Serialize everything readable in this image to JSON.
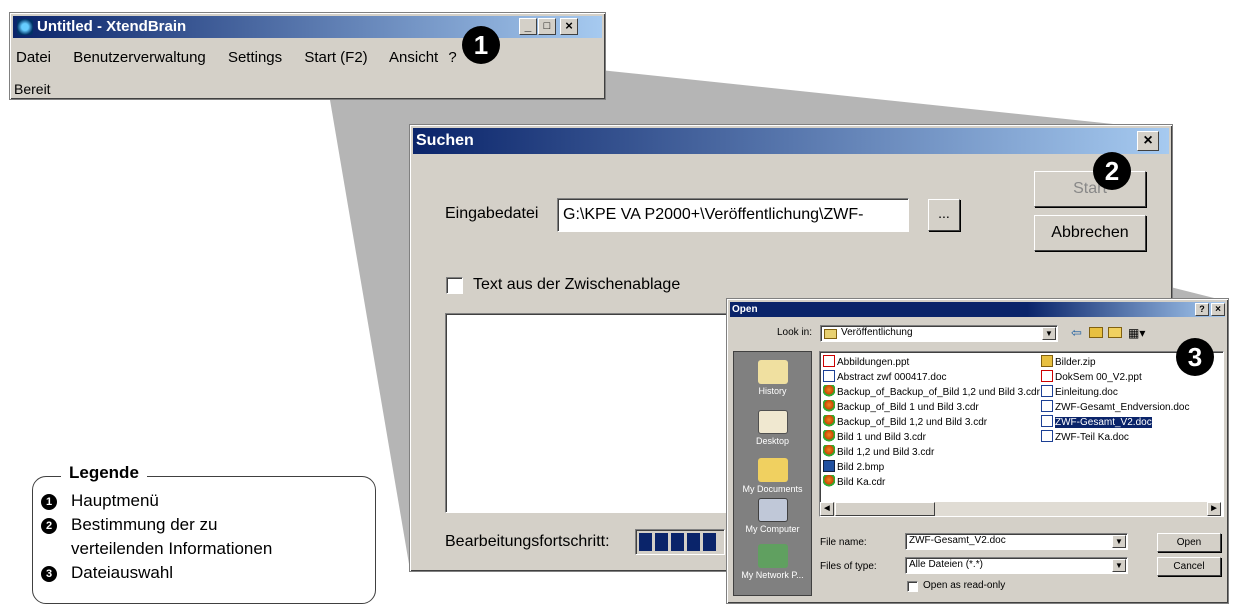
{
  "main_window": {
    "title": "Untitled - XtendBrain",
    "menu": [
      "Datei",
      "Benutzerverwaltung",
      "Settings",
      "Start (F2)",
      "Ansicht",
      "?"
    ],
    "status": "Bereit"
  },
  "search_dialog": {
    "title": "Suchen",
    "input_label": "Eingabedatei",
    "input_value": "G:\\KPE VA P2000+\\Veröffentlichung\\ZWF-",
    "browse_label": "...",
    "start_label": "Start",
    "cancel_label": "Abbrechen",
    "clipboard_label": "Text aus der Zwischenablage",
    "progress_label": "Bearbeitungsfortschritt:",
    "progress_blocks": 5
  },
  "open_dialog": {
    "title": "Open",
    "look_in_label": "Look in:",
    "look_in_value": "Veröffentlichung",
    "places": [
      "History",
      "Desktop",
      "My Documents",
      "My Computer",
      "My Network P..."
    ],
    "files_col1": [
      {
        "name": "Abbildungen.ppt",
        "type": "ppt"
      },
      {
        "name": "Abstract zwf 000417.doc",
        "type": "doc"
      },
      {
        "name": "Backup_of_Backup_of_Bild 1,2 und Bild 3.cdr",
        "type": "cdr"
      },
      {
        "name": "Backup_of_Bild 1 und Bild 3.cdr",
        "type": "cdr"
      },
      {
        "name": "Backup_of_Bild 1,2 und Bild 3.cdr",
        "type": "cdr"
      },
      {
        "name": "Bild 1 und Bild 3.cdr",
        "type": "cdr"
      },
      {
        "name": "Bild 1,2 und Bild 3.cdr",
        "type": "cdr"
      },
      {
        "name": "Bild 2.bmp",
        "type": "bmp"
      },
      {
        "name": "Bild Ka.cdr",
        "type": "cdr"
      }
    ],
    "files_col2": [
      {
        "name": "Bilder.zip",
        "type": "zip"
      },
      {
        "name": "DokSem 00_V2.ppt",
        "type": "ppt"
      },
      {
        "name": "Einleitung.doc",
        "type": "doc"
      },
      {
        "name": "ZWF-Gesamt_Endversion.doc",
        "type": "doc"
      },
      {
        "name": "ZWF-Gesamt_V2.doc",
        "type": "doc",
        "selected": true
      },
      {
        "name": "ZWF-Teil Ka.doc",
        "type": "doc"
      }
    ],
    "file_name_label": "File name:",
    "file_name_value": "ZWF-Gesamt_V2.doc",
    "file_type_label": "Files of type:",
    "file_type_value": "Alle Dateien (*.*)",
    "readonly_label": "Open as read-only",
    "open_label": "Open",
    "cancel_label": "Cancel",
    "help_label": "?",
    "close_label": "×"
  },
  "legend": {
    "title": "Legende",
    "items": [
      {
        "num": "1",
        "text": "Hauptmenü"
      },
      {
        "num": "2",
        "text": "Bestimmung der zu"
      },
      {
        "num": "",
        "text": "verteilenden Informationen"
      },
      {
        "num": "3",
        "text": "Dateiauswahl"
      }
    ]
  },
  "badges": [
    "1",
    "2",
    "3"
  ]
}
